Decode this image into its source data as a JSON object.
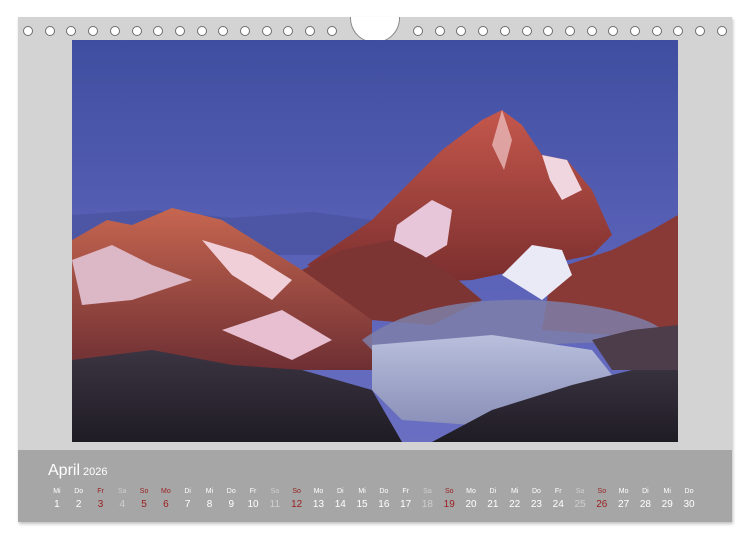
{
  "calendar": {
    "month": "April",
    "year": "2026",
    "days": [
      {
        "dn": "Mi",
        "d": "1",
        "t": "n"
      },
      {
        "dn": "Do",
        "d": "2",
        "t": "n"
      },
      {
        "dn": "Fr",
        "d": "3",
        "t": "h"
      },
      {
        "dn": "Sa",
        "d": "4",
        "t": "s"
      },
      {
        "dn": "So",
        "d": "5",
        "t": "h"
      },
      {
        "dn": "Mo",
        "d": "6",
        "t": "h"
      },
      {
        "dn": "Di",
        "d": "7",
        "t": "n"
      },
      {
        "dn": "Mi",
        "d": "8",
        "t": "n"
      },
      {
        "dn": "Do",
        "d": "9",
        "t": "n"
      },
      {
        "dn": "Fr",
        "d": "10",
        "t": "n"
      },
      {
        "dn": "Sa",
        "d": "11",
        "t": "s"
      },
      {
        "dn": "So",
        "d": "12",
        "t": "h"
      },
      {
        "dn": "Mo",
        "d": "13",
        "t": "n"
      },
      {
        "dn": "Di",
        "d": "14",
        "t": "n"
      },
      {
        "dn": "Mi",
        "d": "15",
        "t": "n"
      },
      {
        "dn": "Do",
        "d": "16",
        "t": "n"
      },
      {
        "dn": "Fr",
        "d": "17",
        "t": "n"
      },
      {
        "dn": "Sa",
        "d": "18",
        "t": "s"
      },
      {
        "dn": "So",
        "d": "19",
        "t": "h"
      },
      {
        "dn": "Mo",
        "d": "20",
        "t": "n"
      },
      {
        "dn": "Di",
        "d": "21",
        "t": "n"
      },
      {
        "dn": "Mi",
        "d": "22",
        "t": "n"
      },
      {
        "dn": "Do",
        "d": "23",
        "t": "n"
      },
      {
        "dn": "Fr",
        "d": "24",
        "t": "n"
      },
      {
        "dn": "Sa",
        "d": "25",
        "t": "s"
      },
      {
        "dn": "So",
        "d": "26",
        "t": "h"
      },
      {
        "dn": "Mo",
        "d": "27",
        "t": "n"
      },
      {
        "dn": "Di",
        "d": "28",
        "t": "n"
      },
      {
        "dn": "Mi",
        "d": "29",
        "t": "n"
      },
      {
        "dn": "Do",
        "d": "30",
        "t": "n"
      }
    ]
  },
  "colors": {
    "page": "#d3d3d3",
    "calendar_bar": "#a6a6a6",
    "holiday": "#9a1f1f",
    "saturday": "#cfcfcf"
  },
  "photo_subject": "alpine-peak-at-sunset"
}
